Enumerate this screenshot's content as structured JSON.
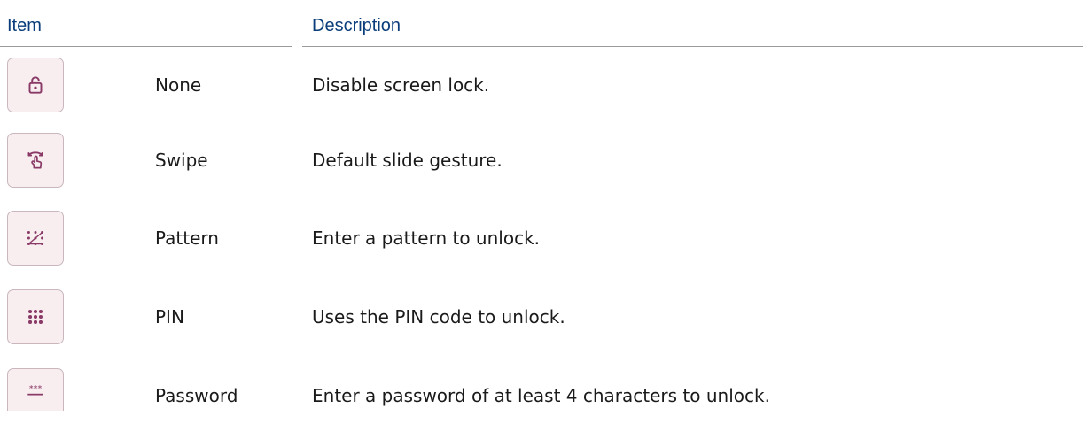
{
  "header": {
    "item": "Item",
    "description": "Description"
  },
  "rows": [
    {
      "icon": "lock-open-icon",
      "item": "None",
      "description": "Disable screen lock."
    },
    {
      "icon": "swipe-gesture-icon",
      "item": "Swipe",
      "description": "Default slide gesture."
    },
    {
      "icon": "pattern-icon",
      "item": "Pattern",
      "description": "Enter a pattern to unlock."
    },
    {
      "icon": "pin-keypad-icon",
      "item": "PIN",
      "description": "Uses the PIN code to unlock."
    },
    {
      "icon": "password-icon",
      "item": "Password",
      "description": "Enter a password of at least 4 characters to unlock."
    }
  ],
  "colors": {
    "header_text": "#0a3d7a",
    "icon": "#8a3a66",
    "icon_bg": "#f8eef0",
    "icon_border": "#c9b7bd"
  }
}
